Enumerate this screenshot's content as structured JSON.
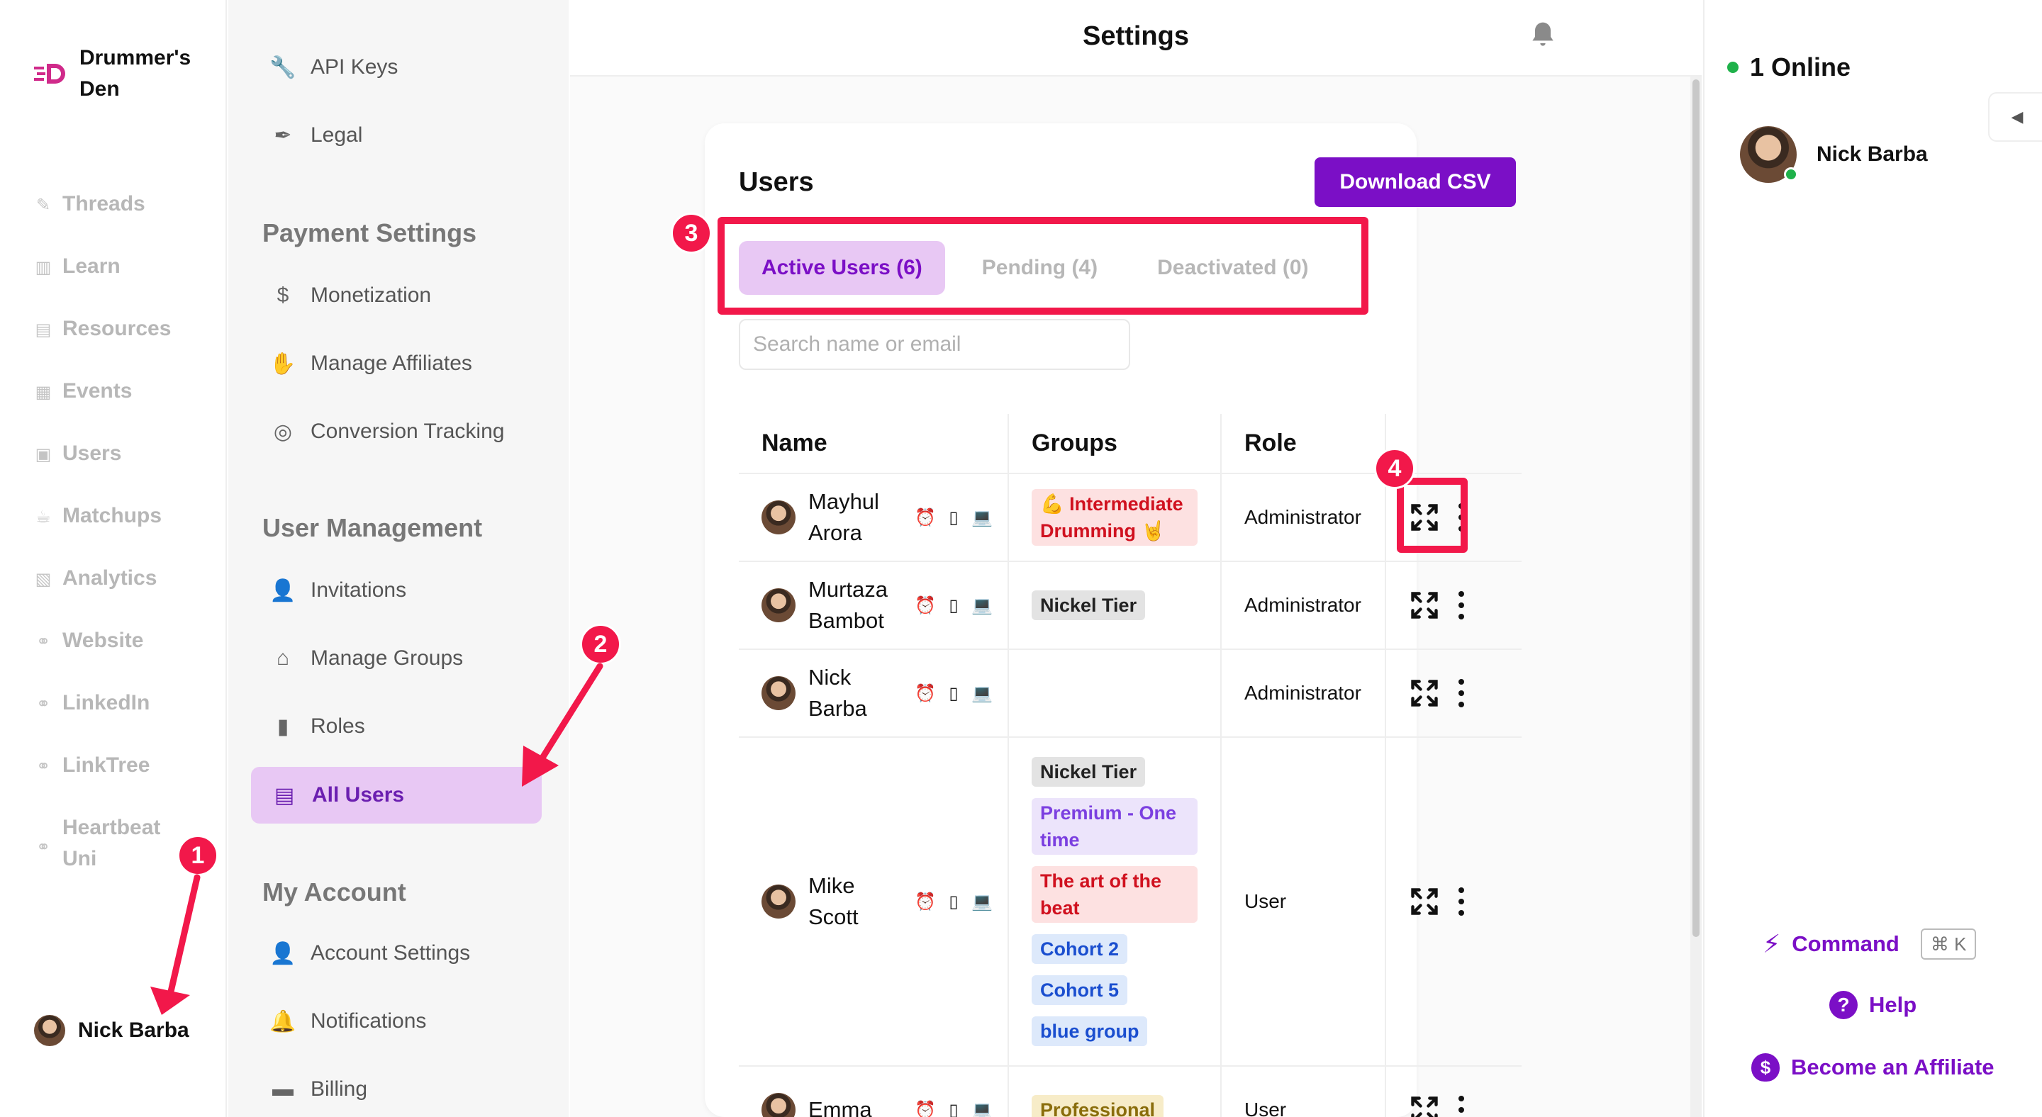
{
  "brand": {
    "name": "Drummer's Den"
  },
  "left_nav": [
    {
      "label": "Threads",
      "icon": "feather-icon"
    },
    {
      "label": "Learn",
      "icon": "book-icon"
    },
    {
      "label": "Resources",
      "icon": "document-icon"
    },
    {
      "label": "Events",
      "icon": "calendar-icon"
    },
    {
      "label": "Users",
      "icon": "user-card-icon"
    },
    {
      "label": "Matchups",
      "icon": "mug-icon"
    },
    {
      "label": "Analytics",
      "icon": "chart-icon"
    },
    {
      "label": "Website",
      "icon": "link-icon"
    },
    {
      "label": "LinkedIn",
      "icon": "link-icon"
    },
    {
      "label": "LinkTree",
      "icon": "link-icon"
    },
    {
      "label": "Heartbeat Uni",
      "icon": "link-icon"
    }
  ],
  "current_user": {
    "name": "Nick Barba"
  },
  "settings_nav": {
    "top_items": [
      {
        "label": "API Keys",
        "icon": "wrench-icon"
      },
      {
        "label": "Legal",
        "icon": "quill-icon"
      }
    ],
    "payment_heading": "Payment Settings",
    "payment_items": [
      {
        "label": "Monetization",
        "icon": "dollar-icon"
      },
      {
        "label": "Manage Affiliates",
        "icon": "hand-coin-icon"
      },
      {
        "label": "Conversion Tracking",
        "icon": "target-icon"
      }
    ],
    "user_mgmt_heading": "User Management",
    "user_mgmt_items": [
      {
        "label": "Invitations",
        "icon": "user-plus-icon"
      },
      {
        "label": "Manage Groups",
        "icon": "house-icon"
      },
      {
        "label": "Roles",
        "icon": "book-icon"
      },
      {
        "label": "All Users",
        "icon": "id-card-icon"
      }
    ],
    "account_heading": "My Account",
    "account_items": [
      {
        "label": "Account Settings",
        "icon": "person-icon"
      },
      {
        "label": "Notifications",
        "icon": "bell-icon"
      },
      {
        "label": "Billing",
        "icon": "card-icon"
      }
    ]
  },
  "header": {
    "title": "Settings"
  },
  "users_card": {
    "title": "Users",
    "download_label": "Download CSV",
    "tabs": [
      "Active Users (6)",
      "Pending (4)",
      "Deactivated (0)"
    ],
    "search_placeholder": "Search name or email",
    "columns": [
      "Name",
      "Groups",
      "Role",
      ""
    ],
    "rows": [
      {
        "first": "Mayhul",
        "last": "Arora",
        "groups": [
          {
            "label": "💪 Intermediate Drumming 🤘",
            "color": "red"
          }
        ],
        "role": "Administrator"
      },
      {
        "first": "Murtaza",
        "last": "Bambot",
        "groups": [
          {
            "label": "Nickel Tier",
            "color": "gray"
          }
        ],
        "role": "Administrator"
      },
      {
        "first": "Nick",
        "last": "Barba",
        "groups": [],
        "role": "Administrator"
      },
      {
        "first": "Mike",
        "last": "Scott",
        "groups": [
          {
            "label": "Nickel Tier",
            "color": "gray"
          },
          {
            "label": "Premium - One time",
            "color": "purple"
          },
          {
            "label": "The art of the beat",
            "color": "red"
          },
          {
            "label": "Cohort 2",
            "color": "blue"
          },
          {
            "label": "Cohort 5",
            "color": "blue"
          },
          {
            "label": "blue group",
            "color": "blue"
          }
        ],
        "role": "User"
      },
      {
        "first": "Emma",
        "last": "",
        "groups": [
          {
            "label": "Professional",
            "color": "olive"
          }
        ],
        "role": "User"
      }
    ]
  },
  "right_panel": {
    "online_label": "1 Online",
    "online_user": "Nick Barba",
    "command_label": "Command",
    "command_shortcut": "⌘ K",
    "help_label": "Help",
    "affiliate_label": "Become an Affiliate"
  },
  "annotations": [
    "1",
    "2",
    "3",
    "4"
  ],
  "colors": {
    "accent": "#7b0fc6",
    "accent_soft": "#e8c8f4",
    "annotation": "#f2184a",
    "online": "#1fb14a"
  }
}
